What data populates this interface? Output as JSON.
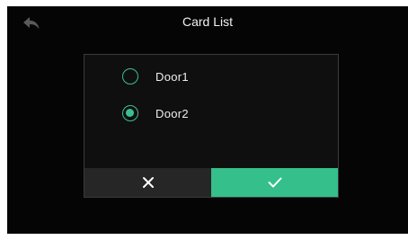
{
  "header": {
    "title": "Card List",
    "back_icon": "back-arrow-icon"
  },
  "dialog": {
    "options": [
      {
        "label": "Door1",
        "selected": false
      },
      {
        "label": "Door2",
        "selected": true
      }
    ],
    "cancel_icon": "close-icon",
    "confirm_icon": "check-icon"
  },
  "colors": {
    "background": "#050505",
    "dialog_background": "#0f0f0f",
    "accent": "#34bf8b",
    "cancel_button": "#262626",
    "text": "#eeeeee"
  }
}
